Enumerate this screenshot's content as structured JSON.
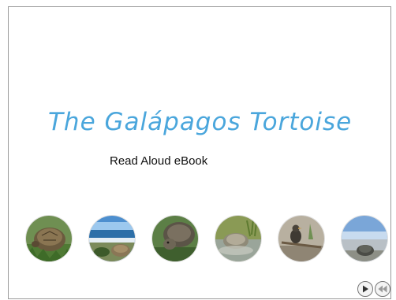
{
  "slide": {
    "title": "The Galápagos Tortoise",
    "subtitle": "Read Aloud eBook"
  },
  "colors": {
    "title": "#4aa6dc",
    "border": "#9a9a9a"
  },
  "thumbnails": [
    {
      "name": "thumb-tortoise-grass",
      "subject": "tortoise-in-grass-photo"
    },
    {
      "name": "thumb-beach-tortoise",
      "subject": "tortoise-on-beach-photo"
    },
    {
      "name": "thumb-tortoise-head",
      "subject": "tortoise-close-up-photo"
    },
    {
      "name": "thumb-tortoise-pond",
      "subject": "tortoise-in-pond-photo"
    },
    {
      "name": "thumb-bird",
      "subject": "bird-on-branch-photo"
    },
    {
      "name": "thumb-tortoise-shore",
      "subject": "tortoise-on-shore-photo"
    }
  ],
  "nav": {
    "play_icon": "play-icon",
    "rewind_icon": "rewind-icon"
  }
}
